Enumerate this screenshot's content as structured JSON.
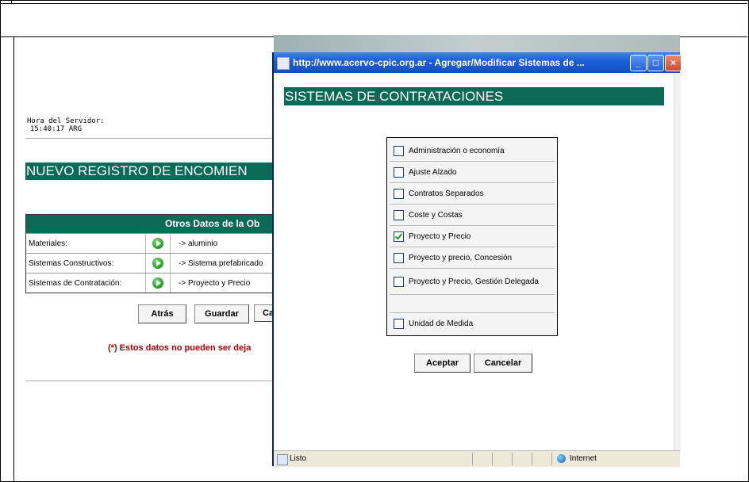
{
  "server": {
    "label": "Hora del Servidor:",
    "time": "15:40:17 ARG"
  },
  "page_title": "NUEVO REGISTRO DE ENCOMIEN",
  "otros_datos": {
    "header": "Otros Datos de la Ob",
    "rows": [
      {
        "label": "Materiales:",
        "value": "-> aluminio"
      },
      {
        "label": "Sistemas Constructivos:",
        "value": "-> Sistema prefabricado"
      },
      {
        "label": "Sistemas de Contratación:",
        "value": "-> Proyecto y Precio"
      }
    ]
  },
  "form_buttons": {
    "back": "Atrás",
    "save": "Guardar",
    "cancel_partial": "Ca"
  },
  "warning": "(*) Estos datos no pueden ser deja",
  "popup": {
    "window_title": "http://www.acervo-cpic.org.ar - Agregar/Modificar Sistemas de ...",
    "heading": "SISTEMAS DE CONTRATACIONES",
    "options": [
      {
        "label": "Administración o economía",
        "checked": false
      },
      {
        "label": "Ajuste Alzado",
        "checked": false
      },
      {
        "label": "Contratos Separados",
        "checked": false
      },
      {
        "label": "Coste y Costas",
        "checked": false
      },
      {
        "label": "Proyecto y Precio",
        "checked": true
      },
      {
        "label": "Proyecto y precio, Concesión",
        "checked": false
      },
      {
        "label": "Proyecto y Precio, Gestión Delegada",
        "checked": false
      },
      {
        "label": "Unidad de Medida",
        "checked": false
      }
    ],
    "accept": "Aceptar",
    "cancel": "Cancelar",
    "status": "Listo",
    "zone": "Internet"
  },
  "colors": {
    "accent": "#0b6a55",
    "warning": "#b00000",
    "titlebar": "#1c5fd6"
  }
}
